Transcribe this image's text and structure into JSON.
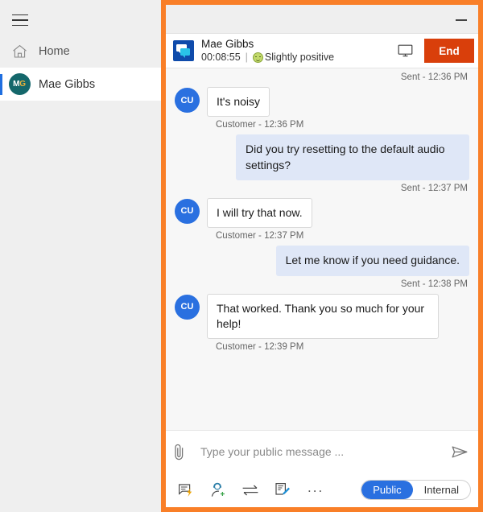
{
  "sidebar": {
    "menu_icon": "hamburger-icon",
    "items": [
      {
        "icon": "home-icon",
        "label": "Home",
        "active": false
      },
      {
        "icon": "avatar",
        "label": "Mae Gibbs",
        "initials_1": "M",
        "initials_2": "G",
        "active": true
      }
    ]
  },
  "window": {
    "minimize_label": "Minimize"
  },
  "conversation": {
    "icon": "chat-bubbles-icon",
    "customer_name": "Mae Gibbs",
    "duration": "00:08:55",
    "separator": "|",
    "sentiment_icon": "slightly-positive-smiley-icon",
    "sentiment_label": "Slightly positive",
    "screen_share_icon": "monitor-icon",
    "end_label": "End",
    "end_color": "#d93f0b"
  },
  "messages": [
    {
      "kind": "status",
      "align": "right",
      "text": "Sent - 12:36 PM"
    },
    {
      "kind": "incoming",
      "avatar": "CU",
      "text": "It's noisy",
      "meta": "Customer - 12:36 PM"
    },
    {
      "kind": "outgoing",
      "text": "Did you try resetting to the default audio settings?",
      "meta": "Sent - 12:37 PM"
    },
    {
      "kind": "incoming",
      "avatar": "CU",
      "text": "I will try that now.",
      "meta": "Customer - 12:37 PM"
    },
    {
      "kind": "outgoing",
      "text": "Let me know if you need guidance.",
      "meta": "Sent - 12:38 PM"
    },
    {
      "kind": "incoming",
      "avatar": "CU",
      "text": "That worked. Thank you so much for your help!",
      "meta": "Customer - 12:39 PM"
    }
  ],
  "composer": {
    "attach_icon": "paperclip-icon",
    "placeholder": "Type your public message ...",
    "value": "",
    "send_icon": "send-paper-plane-icon",
    "tools": [
      {
        "icon": "quick-reply-icon",
        "name": "quick-replies"
      },
      {
        "icon": "add-agent-icon",
        "name": "consult"
      },
      {
        "icon": "transfer-icon",
        "name": "transfer"
      },
      {
        "icon": "notes-icon",
        "name": "notes"
      }
    ],
    "more_label": "...",
    "visibility": {
      "options": [
        "Public",
        "Internal"
      ],
      "selected": "Public",
      "accent": "#2a70e0"
    }
  },
  "theme": {
    "highlight_border": "#f97f28",
    "avatar_customer": "#2a70e0",
    "avatar_agent": "#14676b",
    "bubble_outgoing": "#dfe7f7"
  }
}
